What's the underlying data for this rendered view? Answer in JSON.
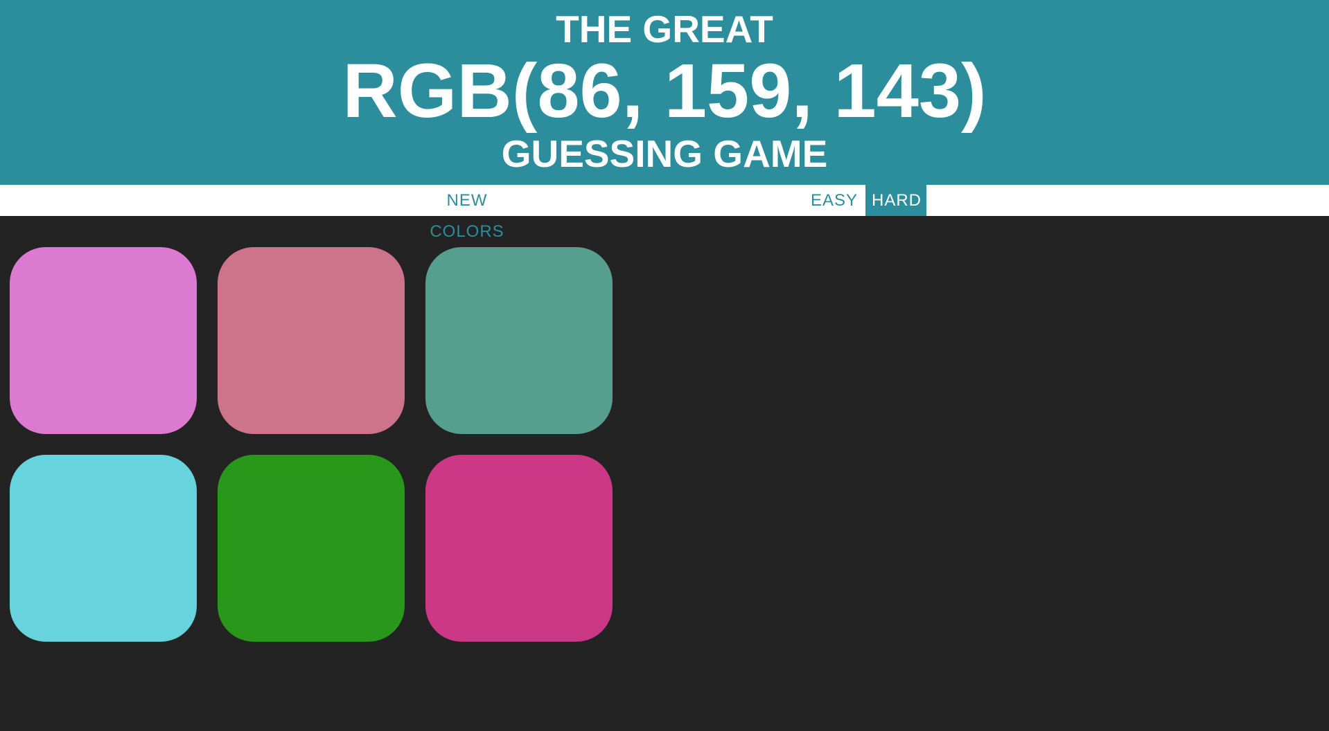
{
  "header": {
    "line1": "THE GREAT",
    "target_rgb": "RGB(86, 159, 143)",
    "line3": "GUESSING GAME",
    "background": "#2c8e9c"
  },
  "controls": {
    "new_colors_label": "NEW COLORS",
    "easy_label": "EASY",
    "hard_label": "HARD",
    "selected_mode": "HARD"
  },
  "squares": [
    {
      "color": "#dc79d0"
    },
    {
      "color": "#cd748c"
    },
    {
      "color": "#569f8f"
    },
    {
      "color": "#67d3dc"
    },
    {
      "color": "#28971a"
    },
    {
      "color": "#cc3786"
    }
  ]
}
